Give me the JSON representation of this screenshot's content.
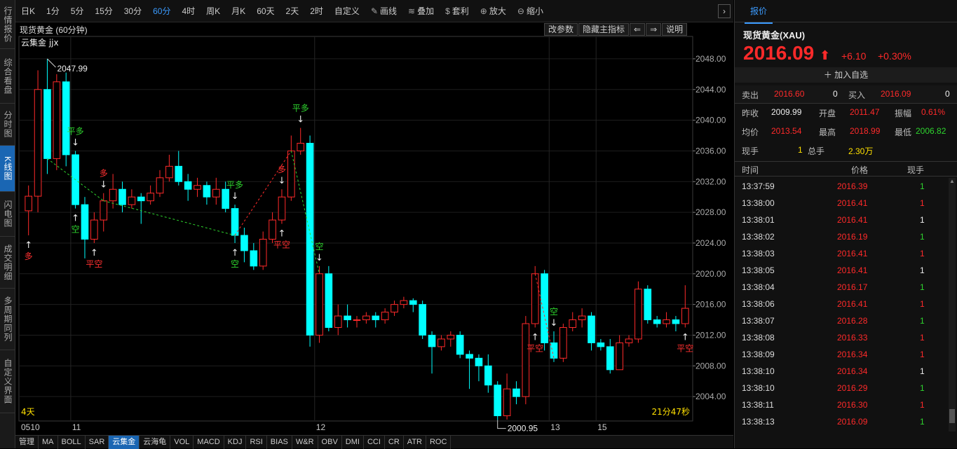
{
  "left_tabs": [
    "行情报价",
    "综合看盘",
    "分时图",
    "K线图",
    "闪电图",
    "成交明细",
    "多周期同列",
    "自定义界面"
  ],
  "toolbar": {
    "items": [
      "日K",
      "1分",
      "5分",
      "15分",
      "30分",
      "60分",
      "4时",
      "周K",
      "月K",
      "60天",
      "2天",
      "2时",
      "自定义"
    ],
    "active": "60分",
    "tools": [
      {
        "icon": "pencil-icon",
        "label": "画线"
      },
      {
        "icon": "stack-icon",
        "label": "叠加"
      },
      {
        "icon": "moneybag-icon",
        "label": "套利"
      },
      {
        "icon": "zoom-in-icon",
        "label": "放大"
      },
      {
        "icon": "zoom-out-icon",
        "label": "缩小"
      }
    ]
  },
  "chart": {
    "title": "现货黄金 (60分钟)",
    "indicator": "云集金 jjx",
    "buttons": [
      "改参数",
      "隐藏主指标",
      "⇐",
      "⇒",
      "说明"
    ],
    "left_bottom": "4天",
    "countdown": "21分47秒",
    "max_label": "2047.99",
    "min_label": "2000.95"
  },
  "chart_data": {
    "type": "candlestick",
    "ylim": [
      2000,
      2050
    ],
    "y_ticks": [
      2048,
      2044,
      2040,
      2036,
      2032,
      2028,
      2024,
      2020,
      2016,
      2012,
      2008,
      2004
    ],
    "date_labels": [
      "0510",
      "11",
      "12",
      "13",
      "15"
    ],
    "candles": [
      [
        2028.2,
        2030.1,
        2031.5,
        2025.0
      ],
      [
        2030.1,
        2044.0,
        2046.5,
        2028.0
      ],
      [
        2044.0,
        2035.0,
        2047.99,
        2033.0
      ],
      [
        2035.0,
        2045.0,
        2046.0,
        2033.5
      ],
      [
        2045.0,
        2035.5,
        2046.2,
        2034.0
      ],
      [
        2035.5,
        2029.0,
        2036.0,
        2028.5
      ],
      [
        2029.0,
        2024.5,
        2030.0,
        2022.0
      ],
      [
        2024.5,
        2027.0,
        2028.0,
        2024.0
      ],
      [
        2027.0,
        2029.5,
        2030.5,
        2025.5
      ],
      [
        2029.5,
        2031.0,
        2033.0,
        2028.5
      ],
      [
        2031.0,
        2029.0,
        2032.0,
        2028.0
      ],
      [
        2029.0,
        2030.0,
        2031.0,
        2028.5
      ],
      [
        2030.0,
        2029.5,
        2030.5,
        2026.5
      ],
      [
        2029.5,
        2030.5,
        2031.5,
        2029.0
      ],
      [
        2030.5,
        2032.5,
        2033.5,
        2030.0
      ],
      [
        2032.5,
        2034.0,
        2035.5,
        2032.0
      ],
      [
        2034.0,
        2032.0,
        2036.0,
        2031.5
      ],
      [
        2032.0,
        2031.0,
        2033.0,
        2029.5
      ],
      [
        2031.0,
        2031.5,
        2032.5,
        2030.0
      ],
      [
        2031.5,
        2030.0,
        2032.0,
        2029.0
      ],
      [
        2030.0,
        2031.0,
        2032.5,
        2029.0
      ],
      [
        2031.0,
        2028.5,
        2032.0,
        2028.0
      ],
      [
        2028.5,
        2025.0,
        2029.0,
        2024.0
      ],
      [
        2025.0,
        2023.0,
        2026.0,
        2021.5
      ],
      [
        2023.0,
        2021.0,
        2024.0,
        2020.5
      ],
      [
        2021.0,
        2024.5,
        2025.5,
        2020.5
      ],
      [
        2024.5,
        2027.0,
        2028.0,
        2024.0
      ],
      [
        2027.0,
        2030.0,
        2031.0,
        2026.5
      ],
      [
        2030.0,
        2036.0,
        2038.0,
        2029.5
      ],
      [
        2036.0,
        2037.0,
        2039.0,
        2035.5
      ],
      [
        2037.0,
        2012.0,
        2038.0,
        2010.5
      ],
      [
        2012.0,
        2020.0,
        2021.0,
        2011.0
      ],
      [
        2020.0,
        2013.0,
        2021.0,
        2012.5
      ],
      [
        2013.0,
        2014.5,
        2016.0,
        2012.0
      ],
      [
        2014.5,
        2014.0,
        2016.0,
        2013.0
      ],
      [
        2014.0,
        2014.0,
        2014.5,
        2013.0
      ],
      [
        2014.0,
        2014.5,
        2015.0,
        2013.5
      ],
      [
        2014.5,
        2014.0,
        2015.0,
        2013.0
      ],
      [
        2014.0,
        2015.0,
        2015.5,
        2013.5
      ],
      [
        2015.0,
        2016.0,
        2016.5,
        2014.5
      ],
      [
        2016.0,
        2016.5,
        2017.0,
        2015.5
      ],
      [
        2016.5,
        2016.0,
        2016.8,
        2015.0
      ],
      [
        2016.0,
        2012.0,
        2016.5,
        2011.5
      ],
      [
        2012.0,
        2010.5,
        2012.5,
        2007.0
      ],
      [
        2010.5,
        2011.5,
        2012.0,
        2010.0
      ],
      [
        2011.5,
        2012.0,
        2012.5,
        2010.5
      ],
      [
        2012.0,
        2009.5,
        2012.5,
        2009.0
      ],
      [
        2009.5,
        2009.0,
        2010.0,
        2005.0
      ],
      [
        2009.0,
        2008.0,
        2009.5,
        2006.0
      ],
      [
        2008.0,
        2005.5,
        2009.5,
        2004.5
      ],
      [
        2005.5,
        2001.5,
        2006.0,
        2000.95
      ],
      [
        2001.5,
        2005.0,
        2007.0,
        2001.0
      ],
      [
        2005.0,
        2004.0,
        2006.0,
        2003.0
      ],
      [
        2004.0,
        2013.5,
        2014.5,
        2003.0
      ],
      [
        2013.5,
        2020.0,
        2021.0,
        2013.0
      ],
      [
        2020.0,
        2011.0,
        2020.5,
        2010.0
      ],
      [
        2011.0,
        2009.0,
        2012.5,
        2008.5
      ],
      [
        2009.0,
        2013.0,
        2013.5,
        2008.5
      ],
      [
        2013.0,
        2014.0,
        2015.0,
        2012.5
      ],
      [
        2014.0,
        2014.5,
        2015.5,
        2013.0
      ],
      [
        2014.5,
        2011.0,
        2015.0,
        2010.0
      ],
      [
        2011.0,
        2010.5,
        2011.5,
        2010.0
      ],
      [
        2010.5,
        2007.5,
        2011.5,
        2007.0
      ],
      [
        2007.5,
        2011.0,
        2012.0,
        2007.5
      ],
      [
        2011.0,
        2011.5,
        2012.0,
        2010.5
      ],
      [
        2011.5,
        2018.0,
        2019.0,
        2011.0
      ],
      [
        2018.0,
        2014.0,
        2018.5,
        2013.5
      ],
      [
        2014.0,
        2013.5,
        2014.5,
        2013.0
      ],
      [
        2013.5,
        2014.0,
        2015.0,
        2013.0
      ],
      [
        2014.0,
        2013.5,
        2014.5,
        2012.5
      ],
      [
        2013.5,
        2015.5,
        2018.5,
        2013.0
      ]
    ],
    "signals": [
      {
        "i": 0,
        "text": "多",
        "pos": "below",
        "color": "red"
      },
      {
        "i": 5,
        "text": "平多",
        "pos": "above",
        "color": "green"
      },
      {
        "i": 5,
        "text": "空",
        "pos": "below",
        "color": "green"
      },
      {
        "i": 7,
        "text": "平空",
        "pos": "below",
        "color": "red"
      },
      {
        "i": 8,
        "text": "多",
        "pos": "above",
        "color": "red"
      },
      {
        "i": 22,
        "text": "平多",
        "pos": "above",
        "color": "green"
      },
      {
        "i": 22,
        "text": "空",
        "pos": "below",
        "color": "green"
      },
      {
        "i": 27,
        "text": "平空",
        "pos": "below",
        "color": "red"
      },
      {
        "i": 27,
        "text": "多",
        "pos": "above",
        "color": "red"
      },
      {
        "i": 29,
        "text": "平多",
        "pos": "above",
        "color": "green"
      },
      {
        "i": 31,
        "text": "空",
        "pos": "above",
        "color": "green"
      },
      {
        "i": 54,
        "text": "平空",
        "pos": "below",
        "color": "red"
      },
      {
        "i": 56,
        "text": "空",
        "pos": "above",
        "color": "green"
      },
      {
        "i": 70,
        "text": "平空",
        "pos": "below",
        "color": "red"
      }
    ],
    "date_indices": [
      0,
      5,
      31,
      56,
      61
    ]
  },
  "bottom_tabs": [
    "管理",
    "MA",
    "BOLL",
    "SAR",
    "云集金",
    "云海龟",
    "VOL",
    "MACD",
    "KDJ",
    "RSI",
    "BIAS",
    "W&R",
    "OBV",
    "DMI",
    "CCI",
    "CR",
    "ATR",
    "ROC"
  ],
  "bottom_active": "云集金",
  "quote": {
    "tab": "报价",
    "symbol": "现货黄金(XAU)",
    "price": "2016.09",
    "change": "+6.10",
    "pct": "+0.30%",
    "add_fav": "加入自选",
    "sell_label": "卖出",
    "sell_price": "2016.60",
    "sell_vol": "0",
    "buy_label": "买入",
    "buy_price": "2016.09",
    "buy_vol": "0",
    "prev_close_label": "昨收",
    "prev_close": "2009.99",
    "open_label": "开盘",
    "open": "2011.47",
    "amp_label": "振幅",
    "amp": "0.61%",
    "avg_label": "均价",
    "avg": "2013.54",
    "high_label": "最高",
    "high": "2018.99",
    "low_label": "最低",
    "low": "2006.82",
    "cur_hand_label": "现手",
    "cur_hand": "1",
    "total_hand_label": "总手",
    "total_hand": "2.30万"
  },
  "ticks_header": {
    "time": "时间",
    "price": "价格",
    "hand": "现手"
  },
  "ticks": [
    {
      "time": "13:37:59",
      "price": "2016.39",
      "hand": "1",
      "color": "green"
    },
    {
      "time": "13:38:00",
      "price": "2016.41",
      "hand": "1",
      "color": "red"
    },
    {
      "time": "13:38:01",
      "price": "2016.41",
      "hand": "1",
      "color": "white"
    },
    {
      "time": "13:38:02",
      "price": "2016.19",
      "hand": "1",
      "color": "green"
    },
    {
      "time": "13:38:03",
      "price": "2016.41",
      "hand": "1",
      "color": "red"
    },
    {
      "time": "13:38:05",
      "price": "2016.41",
      "hand": "1",
      "color": "white"
    },
    {
      "time": "13:38:04",
      "price": "2016.17",
      "hand": "1",
      "color": "green"
    },
    {
      "time": "13:38:06",
      "price": "2016.41",
      "hand": "1",
      "color": "red"
    },
    {
      "time": "13:38:07",
      "price": "2016.28",
      "hand": "1",
      "color": "green"
    },
    {
      "time": "13:38:08",
      "price": "2016.33",
      "hand": "1",
      "color": "red"
    },
    {
      "time": "13:38:09",
      "price": "2016.34",
      "hand": "1",
      "color": "red"
    },
    {
      "time": "13:38:10",
      "price": "2016.34",
      "hand": "1",
      "color": "white"
    },
    {
      "time": "13:38:10",
      "price": "2016.29",
      "hand": "1",
      "color": "green"
    },
    {
      "time": "13:38:11",
      "price": "2016.30",
      "hand": "1",
      "color": "red"
    },
    {
      "time": "13:38:13",
      "price": "2016.09",
      "hand": "1",
      "color": "green"
    }
  ]
}
